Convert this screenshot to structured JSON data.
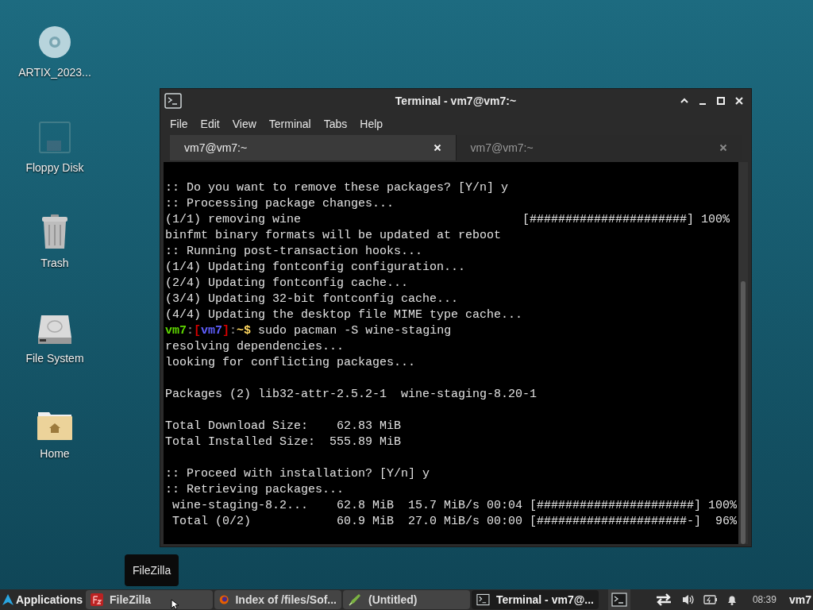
{
  "desktop_icons": [
    {
      "kind": "disc",
      "label": "ARTIX_2023..."
    },
    {
      "kind": "floppy",
      "label": "Floppy Disk"
    },
    {
      "kind": "trash",
      "label": "Trash"
    },
    {
      "kind": "drive",
      "label": "File System"
    },
    {
      "kind": "home",
      "label": "Home"
    }
  ],
  "window": {
    "title": "Terminal - vm7@vm7:~",
    "menu": [
      "File",
      "Edit",
      "View",
      "Terminal",
      "Tabs",
      "Help"
    ],
    "tabs": [
      {
        "label": "vm7@vm7:~",
        "selected": true
      },
      {
        "label": "vm7@vm7:~",
        "selected": false
      }
    ],
    "lines": [
      {
        "kind": "blank"
      },
      {
        "kind": "text",
        "text": ":: Do you want to remove these packages? [Y/n] y"
      },
      {
        "kind": "text",
        "text": ":: Processing package changes..."
      },
      {
        "kind": "text",
        "text": "(1/1) removing wine                               [######################] 100%"
      },
      {
        "kind": "text",
        "text": "binfmt binary formats will be updated at reboot"
      },
      {
        "kind": "text",
        "text": ":: Running post-transaction hooks..."
      },
      {
        "kind": "text",
        "text": "(1/4) Updating fontconfig configuration..."
      },
      {
        "kind": "text",
        "text": "(2/4) Updating fontconfig cache..."
      },
      {
        "kind": "text",
        "text": "(3/4) Updating 32-bit fontconfig cache..."
      },
      {
        "kind": "text",
        "text": "(4/4) Updating the desktop file MIME type cache..."
      },
      {
        "kind": "prompt",
        "segments": [
          {
            "text": "vm7",
            "color": "#5fd700"
          },
          {
            "text": ":",
            "color": "#808080"
          },
          {
            "text": "[",
            "color": "#d70000"
          },
          {
            "text": "vm7",
            "color": "#5f5fff"
          },
          {
            "text": "]",
            "color": "#d70000"
          },
          {
            "text": ":",
            "color": "#808080"
          },
          {
            "text": "~$",
            "color": "#ffd75f"
          }
        ],
        "command": "sudo pacman -S wine-staging"
      },
      {
        "kind": "text",
        "text": "resolving dependencies..."
      },
      {
        "kind": "text",
        "text": "looking for conflicting packages..."
      },
      {
        "kind": "blank"
      },
      {
        "kind": "text",
        "text": "Packages (2) lib32-attr-2.5.2-1  wine-staging-8.20-1"
      },
      {
        "kind": "blank"
      },
      {
        "kind": "text",
        "text": "Total Download Size:    62.83 MiB"
      },
      {
        "kind": "text",
        "text": "Total Installed Size:  555.89 MiB"
      },
      {
        "kind": "blank"
      },
      {
        "kind": "text",
        "text": ":: Proceed with installation? [Y/n] y"
      },
      {
        "kind": "text",
        "text": ":: Retrieving packages..."
      },
      {
        "kind": "text",
        "text": " wine-staging-8.2...    62.8 MiB  15.7 MiB/s 00:04 [######################] 100%"
      },
      {
        "kind": "text",
        "text": " Total (0/2)            60.9 MiB  27.0 MiB/s 00:00 [#####################-]  96%"
      }
    ]
  },
  "tooltip": "FileZilla",
  "taskbar": {
    "menu_label": "Applications",
    "items": [
      {
        "kind": "filezilla",
        "label": "FileZilla",
        "selected": false
      },
      {
        "kind": "firefox",
        "label": "Index of /files/Sof...",
        "selected": false
      },
      {
        "kind": "editor",
        "label": "(Untitled)",
        "selected": false
      },
      {
        "kind": "terminal",
        "label": "Terminal - vm7@...",
        "selected": true
      }
    ],
    "clock": "08:39",
    "user": "vm7"
  }
}
